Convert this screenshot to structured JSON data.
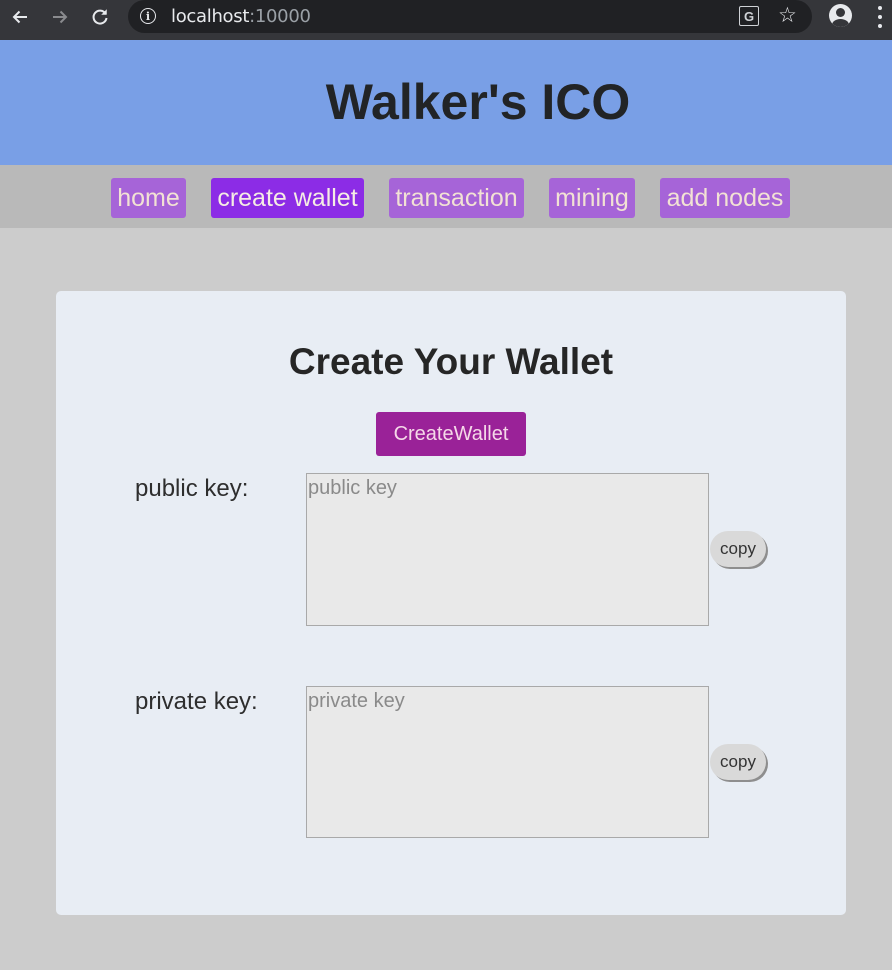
{
  "browser": {
    "back_icon": "arrow-left-icon",
    "forward_icon": "arrow-right-icon",
    "reload_icon": "reload-icon",
    "url_host": "localhost",
    "url_port": ":10000",
    "translate_icon": "translate-icon",
    "star_icon": "star-icon",
    "profile_icon": "profile-icon",
    "menu_icon": "kebab-menu-icon"
  },
  "header": {
    "title": "Walker's ICO",
    "background": "#799fe6"
  },
  "nav": {
    "items": [
      {
        "label": "home",
        "active": false
      },
      {
        "label": "create wallet",
        "active": true
      },
      {
        "label": "transaction",
        "active": false
      },
      {
        "label": "mining",
        "active": false
      },
      {
        "label": "add nodes",
        "active": false
      }
    ],
    "item_color": "#a664d8",
    "active_color": "#8c2ce6"
  },
  "main": {
    "title": "Create Your Wallet",
    "create_button_label": "CreateWallet",
    "create_button_color": "#9a2298",
    "public_key": {
      "label": "public key:",
      "placeholder": "public key",
      "value": "",
      "copy_label": "copy"
    },
    "private_key": {
      "label": "private key:",
      "placeholder": "private key",
      "value": "",
      "copy_label": "copy"
    }
  }
}
